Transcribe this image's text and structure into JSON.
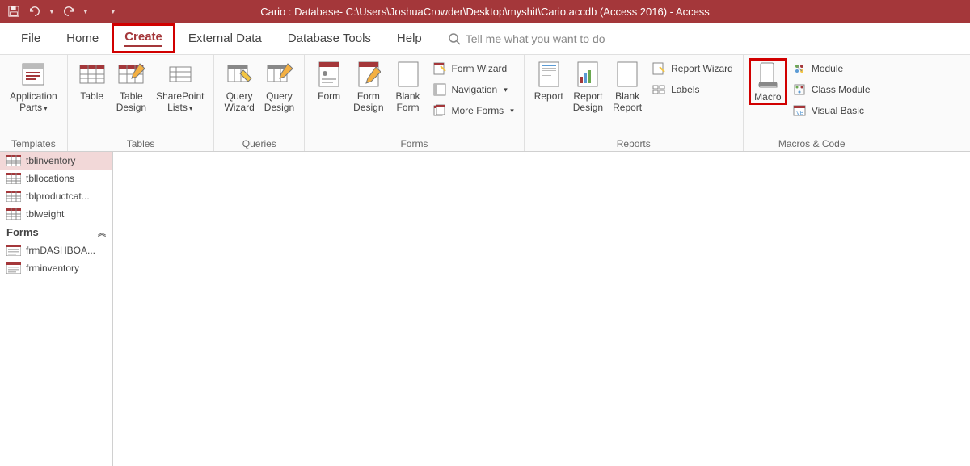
{
  "title": "Cario : Database- C:\\Users\\JoshuaCrowder\\Desktop\\myshit\\Cario.accdb (Access 2016)  -  Access",
  "tabs": {
    "file": "File",
    "home": "Home",
    "create": "Create",
    "external_data": "External Data",
    "database_tools": "Database Tools",
    "help": "Help"
  },
  "search_placeholder": "Tell me what you want to do",
  "groups": {
    "templates": {
      "label": "Templates",
      "app_parts": [
        "Application",
        "Parts"
      ]
    },
    "tables": {
      "label": "Tables",
      "table": "Table",
      "table_design": [
        "Table",
        "Design"
      ],
      "sharepoint_lists": [
        "SharePoint",
        "Lists"
      ]
    },
    "queries": {
      "label": "Queries",
      "query_wizard": [
        "Query",
        "Wizard"
      ],
      "query_design": [
        "Query",
        "Design"
      ]
    },
    "forms": {
      "label": "Forms",
      "form": "Form",
      "form_design": [
        "Form",
        "Design"
      ],
      "blank_form": [
        "Blank",
        "Form"
      ],
      "form_wizard": "Form Wizard",
      "navigation": "Navigation",
      "more_forms": "More Forms"
    },
    "reports": {
      "label": "Reports",
      "report": "Report",
      "report_design": [
        "Report",
        "Design"
      ],
      "blank_report": [
        "Blank",
        "Report"
      ],
      "report_wizard": "Report Wizard",
      "labels": "Labels"
    },
    "macros_code": {
      "label": "Macros & Code",
      "macro": "Macro",
      "module": "Module",
      "class_module": "Class Module",
      "visual_basic": "Visual Basic"
    }
  },
  "nav": {
    "tables": [
      "tblinventory",
      "tbllocations",
      "tblproductcat...",
      "tblweight"
    ],
    "forms_heading": "Forms",
    "forms": [
      "frmDASHBOA...",
      "frminventory"
    ]
  }
}
